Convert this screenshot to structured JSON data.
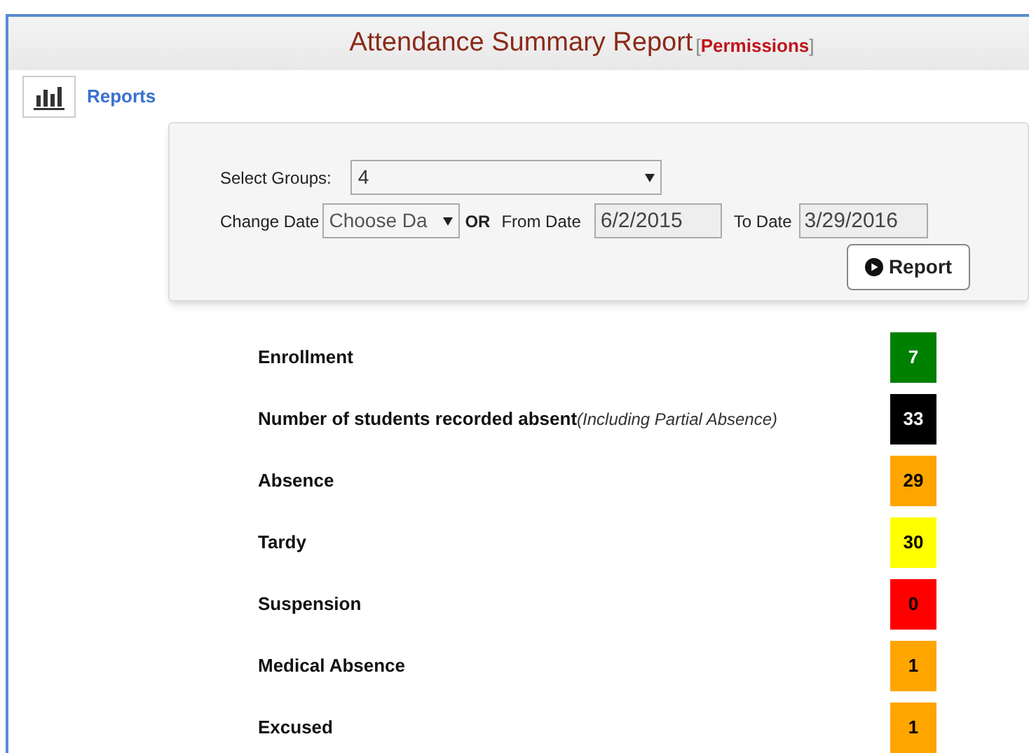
{
  "header": {
    "title": "Attendance Summary Report",
    "bracket_open": "[",
    "link": "Permissions",
    "bracket_close": "]"
  },
  "nav": {
    "label": "Reports"
  },
  "filters": {
    "groups_label": "Select Groups:",
    "groups_value": "4",
    "change_date_label": "Change Date",
    "change_date_value": "Choose Da",
    "or": "OR",
    "from_label": "From Date",
    "from_value": "6/2/2015",
    "to_label": "To Date",
    "to_value": "3/29/2016",
    "button": "Report"
  },
  "metrics": [
    {
      "label": "Enrollment",
      "value": "7",
      "color": "#008000"
    },
    {
      "label": "Number of students recorded absent",
      "note": "(Including Partial Absence)",
      "value": "33",
      "color": "#000000"
    },
    {
      "label": "Absence",
      "value": "29",
      "color": "#ffa500"
    },
    {
      "label": "Tardy",
      "value": "30",
      "color": "#ffff00"
    },
    {
      "label": "Suspension",
      "value": "0",
      "color": "#ff0000"
    },
    {
      "label": "Medical Absence",
      "value": "1",
      "color": "#ffa500"
    },
    {
      "label": "Excused",
      "value": "1",
      "color": "#ffa500"
    }
  ]
}
